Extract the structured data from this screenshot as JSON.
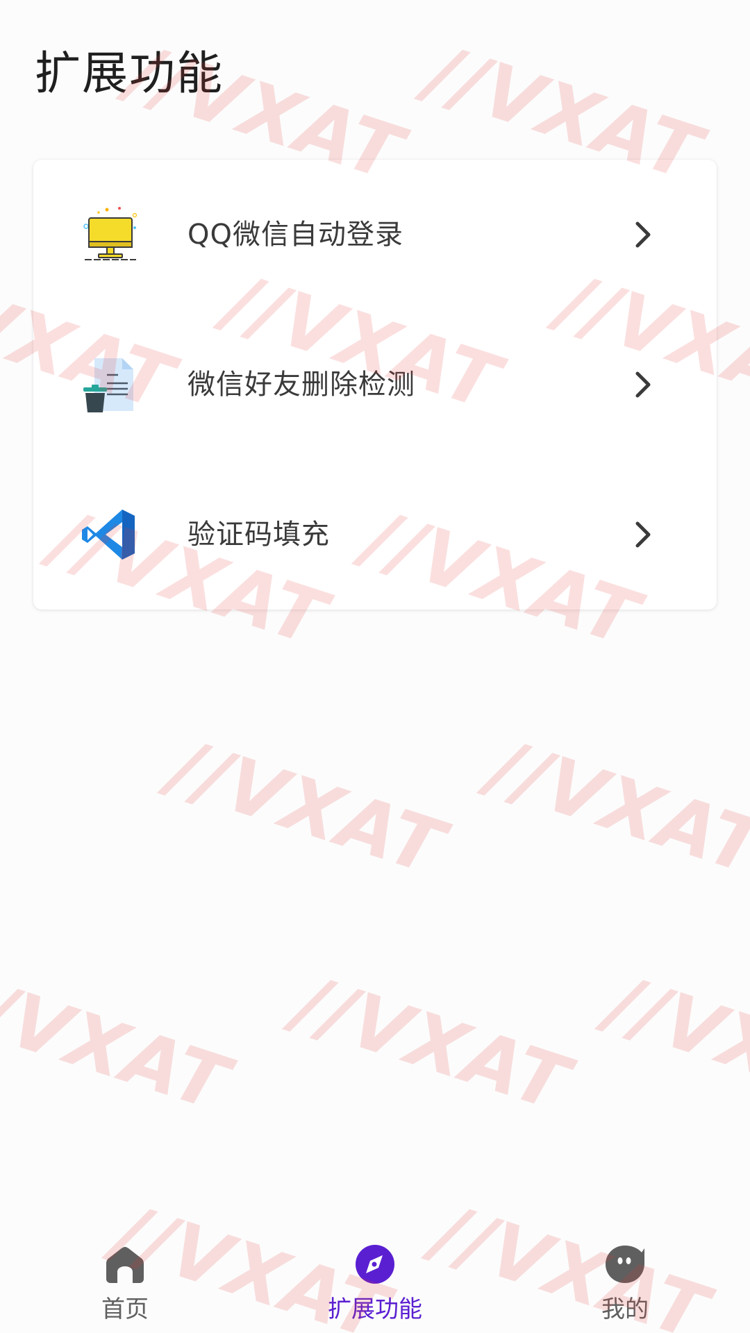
{
  "header": {
    "title": "扩展功能"
  },
  "features": [
    {
      "label": "QQ微信自动登录",
      "icon": "monitor-icon"
    },
    {
      "label": "微信好友删除检测",
      "icon": "document-trash-icon"
    },
    {
      "label": "验证码填充",
      "icon": "code-editor-icon"
    }
  ],
  "bottom_nav": {
    "items": [
      {
        "label": "首页",
        "icon": "home-icon",
        "active": false
      },
      {
        "label": "扩展功能",
        "icon": "compass-icon",
        "active": true
      },
      {
        "label": "我的",
        "icon": "profile-face-icon",
        "active": false
      }
    ]
  },
  "watermark": {
    "text": "//VXAT"
  },
  "colors": {
    "accent": "#5a1fd1",
    "inactive_nav": "#5f5f5f",
    "text": "#3a3a3a",
    "background": "#fcfcfc"
  }
}
